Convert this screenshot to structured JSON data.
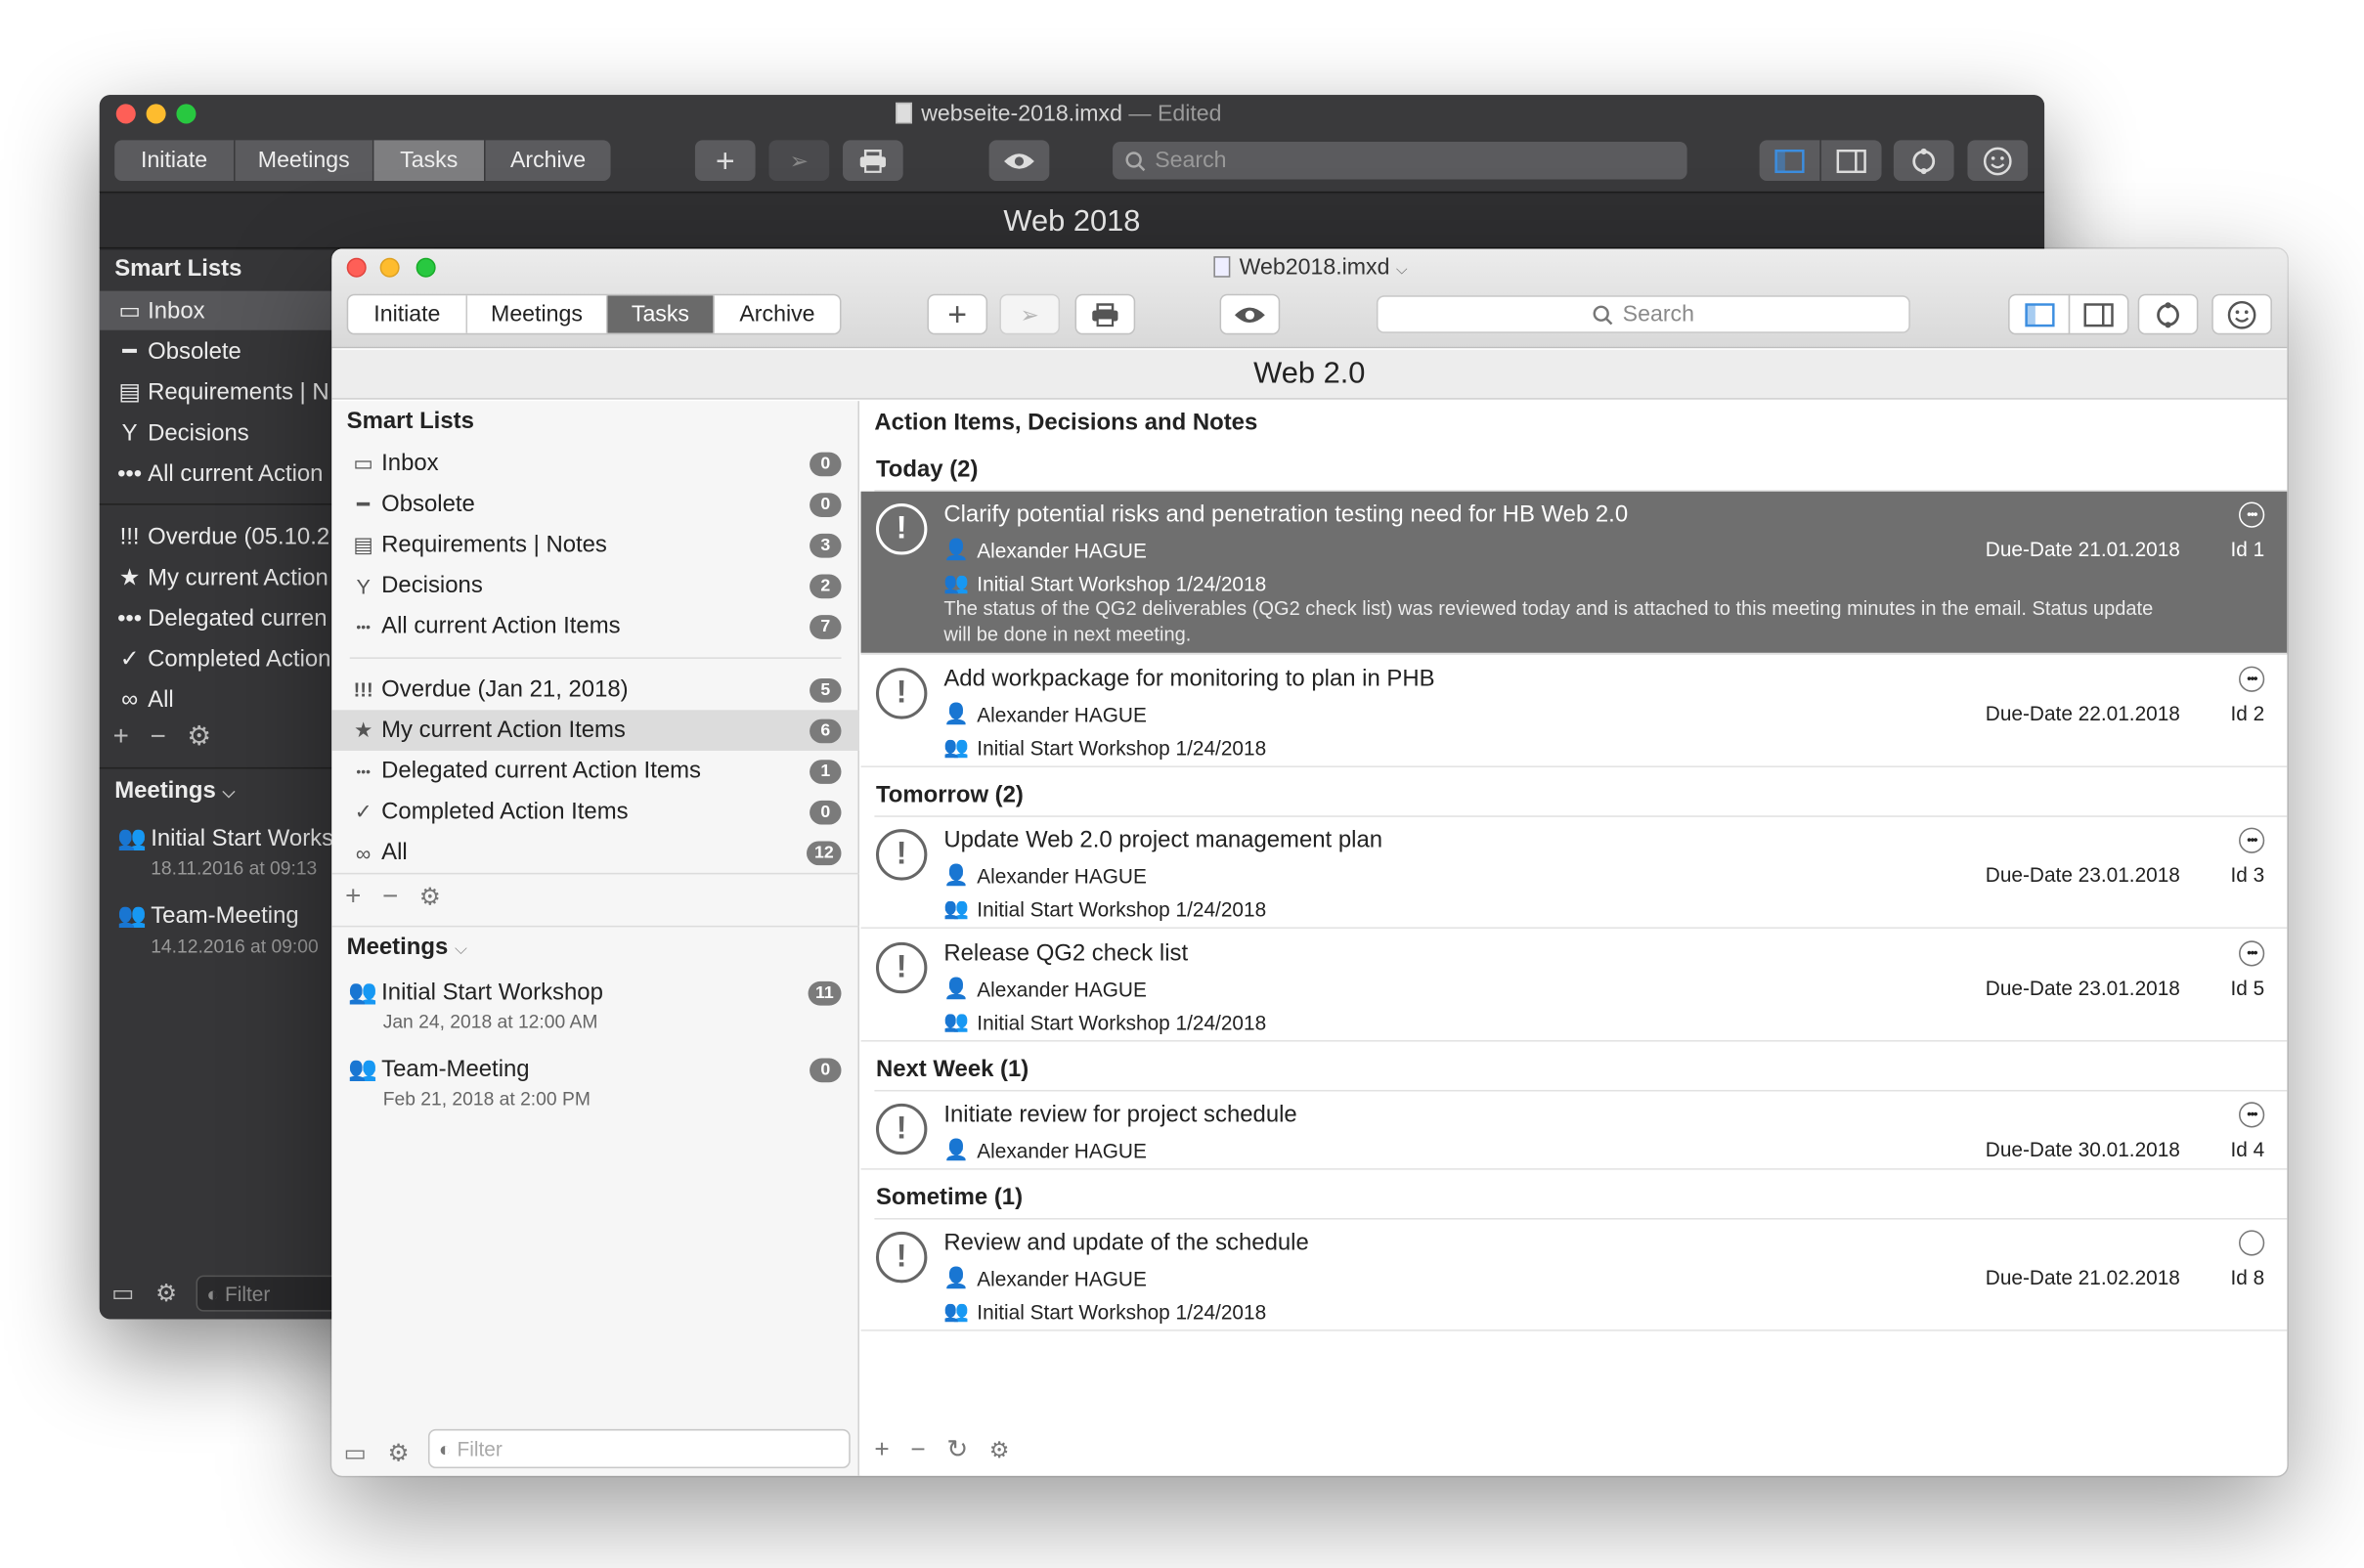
{
  "back_window": {
    "title": "webseite-2018.imxd",
    "title_status": "— Edited",
    "tabs": [
      "Initiate",
      "Meetings",
      "Tasks",
      "Archive"
    ],
    "search_placeholder": "Search",
    "header": "Web 2018",
    "smart_lists_title": "Smart Lists",
    "smart_lists": [
      "Inbox",
      "Obsolete",
      "Requirements | N",
      "Decisions",
      "All current Action"
    ],
    "filters": [
      "Overdue (05.10.2",
      "My current Action",
      "Delegated curren",
      "Completed Action",
      "All"
    ],
    "meetings_title": "Meetings",
    "meetings": [
      {
        "name": "Initial Start Works",
        "date": "18.11.2016 at 09:13"
      },
      {
        "name": "Team-Meeting",
        "date": "14.12.2016 at 09:00"
      }
    ],
    "filter_placeholder": "Filter"
  },
  "window": {
    "title": "Web2018.imxd",
    "tabs": [
      "Initiate",
      "Meetings",
      "Tasks",
      "Archive"
    ],
    "active_tab": "Tasks",
    "search_placeholder": "Search",
    "header": "Web 2.0",
    "filter_placeholder": "Filter"
  },
  "sidebar": {
    "smart_lists_title": "Smart Lists",
    "smart_lists": [
      {
        "label": "Inbox",
        "count": "0",
        "icon": "inbox-icon"
      },
      {
        "label": "Obsolete",
        "count": "0",
        "icon": "dash-icon"
      },
      {
        "label": "Requirements | Notes",
        "count": "3",
        "icon": "notes-icon"
      },
      {
        "label": "Decisions",
        "count": "2",
        "icon": "decision-icon"
      },
      {
        "label": "All current Action Items",
        "count": "7",
        "icon": "dots-icon"
      }
    ],
    "filters": [
      {
        "label": "Overdue (Jan 21, 2018)",
        "count": "5",
        "icon": "overdue-icon"
      },
      {
        "label": "My current Action Items",
        "count": "6",
        "icon": "star-icon"
      },
      {
        "label": "Delegated current Action Items",
        "count": "1",
        "icon": "dots-icon"
      },
      {
        "label": "Completed Action Items",
        "count": "0",
        "icon": "check-icon"
      },
      {
        "label": "All",
        "count": "12",
        "icon": "infinity-icon"
      }
    ],
    "meetings_title": "Meetings",
    "meetings": [
      {
        "name": "Initial Start Workshop",
        "date": "Jan 24, 2018 at 12:00 AM",
        "count": "11"
      },
      {
        "name": "Team-Meeting",
        "date": "Feb 21, 2018 at 2:00 PM",
        "count": "0"
      }
    ]
  },
  "main": {
    "title": "Action Items, Decisions and Notes",
    "groups": [
      {
        "label": "Today (2)",
        "items": [
          {
            "title": "Clarify potential risks and penetration testing need for HB Web 2.0",
            "owner": "Alexander HAGUE",
            "meeting": "Initial Start Workshop 1/24/2018",
            "due": "Due-Date 21.01.2018",
            "id": "Id 1",
            "note": "The status of the QG2 deliverables (QG2 check list) was reviewed today and is attached to this meeting minutes in the email. Status update will be done in next meeting."
          },
          {
            "title": "Add workpackage for monitoring to plan in PHB",
            "owner": "Alexander HAGUE",
            "meeting": "Initial Start Workshop 1/24/2018",
            "due": "Due-Date 22.01.2018",
            "id": "Id 2"
          }
        ]
      },
      {
        "label": "Tomorrow (2)",
        "items": [
          {
            "title": "Update Web 2.0 project management plan",
            "owner": "Alexander HAGUE",
            "meeting": "Initial Start Workshop 1/24/2018",
            "due": "Due-Date 23.01.2018",
            "id": "Id 3"
          },
          {
            "title": "Release QG2 check list",
            "owner": "Alexander HAGUE",
            "meeting": "Initial Start Workshop 1/24/2018",
            "due": "Due-Date 23.01.2018",
            "id": "Id 5"
          }
        ]
      },
      {
        "label": "Next Week (1)",
        "items": [
          {
            "title": "Initiate review for project schedule",
            "owner": "Alexander HAGUE",
            "due": "Due-Date 30.01.2018",
            "id": "Id 4"
          }
        ]
      },
      {
        "label": "Sometime (1)",
        "items": [
          {
            "title": "Review and update of the schedule",
            "owner": "Alexander HAGUE",
            "meeting": "Initial Start Workshop 1/24/2018",
            "due": "Due-Date 21.02.2018",
            "id": "Id 8"
          }
        ]
      }
    ]
  },
  "colors": {
    "selected_row": "#6f6f6f",
    "active_tab": "#6a6a6a",
    "accent_blue": "#3c8ee0"
  }
}
